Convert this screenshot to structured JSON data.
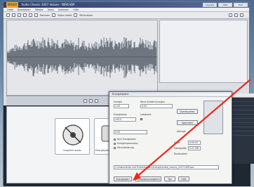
{
  "app": {
    "logo": "MAGIX",
    "title": "Audio Cleanic 2007 deluxe - NEW.HDP",
    "window_controls": [
      "Upgrade",
      "Hilfe",
      "Exit"
    ]
  },
  "menu": [
    "Datei",
    "Bearbeiten",
    "Effekte",
    "Tasks",
    "Optionen",
    "Hilfe"
  ],
  "toolbar": {
    "labels": [
      "Rahmen",
      "Video direkt",
      "Minimieren"
    ]
  },
  "lower_panel": {
    "tiles": [
      {
        "label": "Importer audio"
      },
      {
        "label": "Energieplans"
      }
    ]
  },
  "dialog": {
    "title": "Energieplans",
    "labels": [
      "Energie",
      "Neue Aufzeichnungen",
      "Durchsuchen",
      "Energieplan",
      "Lokalwert",
      "Speichern",
      "Abfrage",
      "Datei",
      "Dateigröße",
      "Restlaufzeit"
    ],
    "options": [
      "Kein Energieplan",
      "Energiesparmodus",
      "Höchstleistung"
    ],
    "path": "C:\\Dokumente und Einstellungen\\Energie\\audio_cleanic_2007.HDP.wav",
    "fields": [
      "1:20",
      "0:00",
      "140.0",
      "0:00",
      "0:00:00",
      "0.01 MB"
    ],
    "buttons": [
      "Energieplan",
      "Energieplanvergleich",
      "Ton",
      "Hilfe"
    ]
  },
  "bottom_table": {
    "header": [
      "Slot",
      "Clip"
    ]
  },
  "colors": {
    "accent": "#e9a23b",
    "arrow": "#e82a1c",
    "titlebar": "#2b3d6a",
    "waveform": "#6f7680"
  }
}
